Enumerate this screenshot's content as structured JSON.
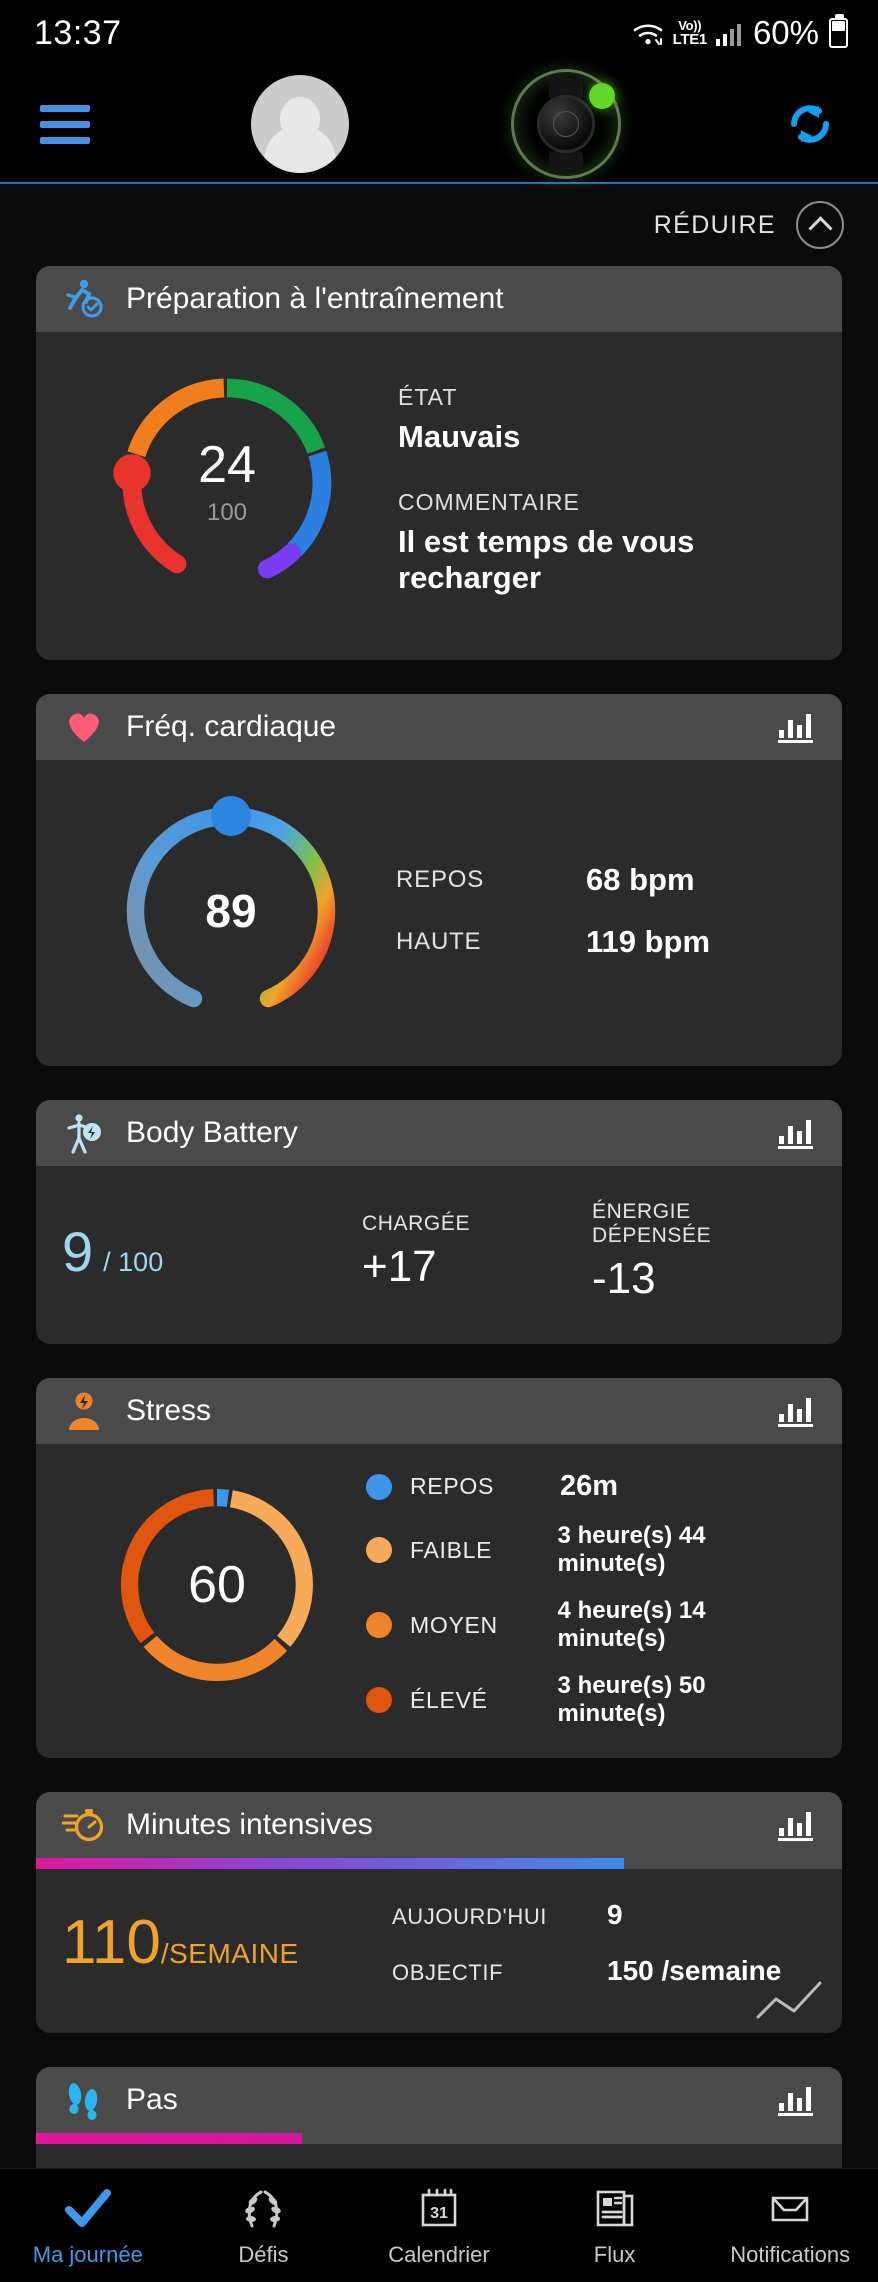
{
  "status_bar": {
    "time": "13:37",
    "network_label_top": "Vo))",
    "network_label_bottom": "LTE1",
    "battery_percent": "60%"
  },
  "app_header": {
    "menu_icon": "hamburger-menu-icon",
    "avatar_icon": "user-avatar",
    "device_icon": "watch-device",
    "sync_icon": "sync-refresh-icon"
  },
  "collapse": {
    "label": "RÉDUIRE",
    "icon": "chevron-up-icon"
  },
  "cards": {
    "training_readiness": {
      "title": "Préparation à l'entraînement",
      "icon": "running-check-icon",
      "score": "24",
      "score_max": "100",
      "state_label": "ÉTAT",
      "state_value": "Mauvais",
      "comment_label": "COMMENTAIRE",
      "comment_value": "Il est temps de vous recharger"
    },
    "heart_rate": {
      "title": "Fréq. cardiaque",
      "icon": "heart-icon",
      "chart_icon": "bar-chart-icon",
      "current": "89",
      "rows": [
        {
          "label": "REPOS",
          "value": "68 bpm"
        },
        {
          "label": "HAUTE",
          "value": "119 bpm"
        }
      ]
    },
    "body_battery": {
      "title": "Body Battery",
      "icon": "body-battery-icon",
      "chart_icon": "bar-chart-icon",
      "value": "9",
      "max": "/ 100",
      "charged_label": "CHARGÉE",
      "charged_value": "+17",
      "spent_label": "ÉNERGIE DÉPENSÉE",
      "spent_value": "-13"
    },
    "stress": {
      "title": "Stress",
      "icon": "stress-person-icon",
      "chart_icon": "bar-chart-icon",
      "score": "60",
      "legend": [
        {
          "name": "REPOS",
          "value": "26m",
          "color": "#3f95e8"
        },
        {
          "name": "FAIBLE",
          "value": "3 heure(s) 44 minute(s)",
          "color": "#f6ab5a"
        },
        {
          "name": "MOYEN",
          "value": "4 heure(s) 14 minute(s)",
          "color": "#f07d1e"
        },
        {
          "name": "ÉLEVÉ",
          "value": "3 heure(s) 50 minute(s)",
          "color": "#e0560f"
        }
      ]
    },
    "intensity_minutes": {
      "title": "Minutes intensives",
      "icon": "stopwatch-icon",
      "chart_icon": "bar-chart-icon",
      "value": "110",
      "unit": "/SEMAINE",
      "today_label": "AUJOURD'HUI",
      "today_value": "9",
      "goal_label": "OBJECTIF",
      "goal_value": "150 /semaine",
      "progress_percent": 73
    },
    "steps": {
      "title": "Pas",
      "icon": "footsteps-icon",
      "chart_icon": "bar-chart-icon",
      "progress_percent": 33
    }
  },
  "bottom_nav": [
    {
      "label": "Ma journée",
      "icon": "check-icon",
      "active": true
    },
    {
      "label": "Défis",
      "icon": "laurel-wreath-icon",
      "active": false
    },
    {
      "label": "Calendrier",
      "icon": "calendar-31-icon",
      "active": false
    },
    {
      "label": "Flux",
      "icon": "newsfeed-icon",
      "active": false
    },
    {
      "label": "Notifications",
      "icon": "inbox-icon",
      "active": false
    }
  ],
  "chart_data": [
    {
      "type": "pie",
      "title": "Préparation à l'entraînement",
      "value": 24,
      "max": 100,
      "segments": [
        {
          "name": "green",
          "color": "#16a34a",
          "start_deg": 0,
          "sweep_deg": 70
        },
        {
          "name": "blue",
          "color": "#2b7fe0",
          "start_deg": 72,
          "sweep_deg": 60
        },
        {
          "name": "purple",
          "color": "#7a3cf0",
          "start_deg": 134,
          "sweep_deg": 24
        },
        {
          "name": "red",
          "color": "#e8342c",
          "start_deg": 182,
          "sweep_deg": 100
        },
        {
          "name": "orange",
          "color": "#f07d1e",
          "start_deg": 284,
          "sweep_deg": 74
        }
      ],
      "marker_color": "#e8342c",
      "marker_deg": 270
    },
    {
      "type": "pie",
      "title": "Fréq. cardiaque",
      "value": 89,
      "gradient": [
        "#5b9bd5",
        "#3f95e8",
        "#7cc24a",
        "#f0a32a",
        "#e8342c",
        "#7f8fa0"
      ],
      "marker_color": "#3f95e8"
    },
    {
      "type": "pie",
      "title": "Stress",
      "value": 60,
      "categories": [
        "REPOS",
        "FAIBLE",
        "MOYEN",
        "ÉLEVÉ"
      ],
      "values": [
        26,
        224,
        254,
        230
      ],
      "value_unit": "minutes",
      "colors": [
        "#3f95e8",
        "#f6ab5a",
        "#f07d1e",
        "#e0560f"
      ]
    },
    {
      "type": "bar",
      "title": "Minutes intensives",
      "categories": [
        "Semaine"
      ],
      "values": [
        110
      ],
      "ylim": [
        0,
        150
      ],
      "ylabel": "minutes"
    }
  ]
}
